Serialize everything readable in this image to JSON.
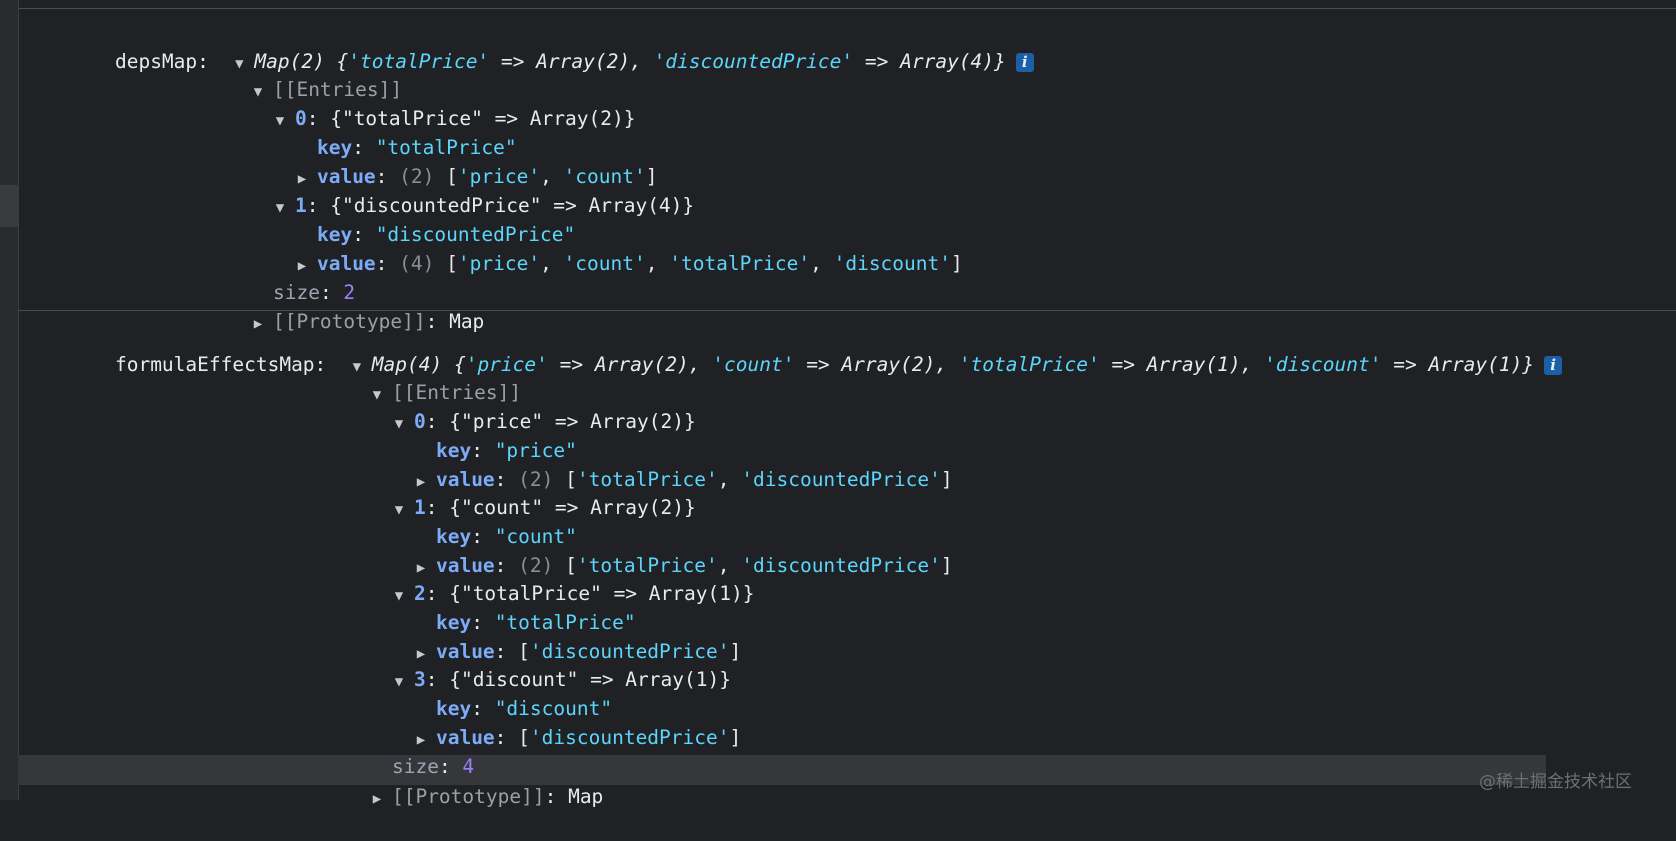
{
  "depsMap": {
    "label": "depsMap:",
    "summary_head": "Map(2) {",
    "summary_k1": "'totalPrice'",
    "summary_v1": " => Array(2), ",
    "summary_k2": "'discountedPrice'",
    "summary_v2": " => Array(4)}",
    "entries_label": "[[Entries]]",
    "entries": [
      {
        "index": "0",
        "summary": " {\"totalPrice\" => Array(2)}",
        "key_label": "key",
        "key_value": "\"totalPrice\"",
        "value_label": "value",
        "value_count": "(2)",
        "value_items": [
          "'price'",
          "'count'"
        ]
      },
      {
        "index": "1",
        "summary": " {\"discountedPrice\" => Array(4)}",
        "key_label": "key",
        "key_value": "\"discountedPrice\"",
        "value_label": "value",
        "value_count": "(4)",
        "value_items": [
          "'price'",
          "'count'",
          "'totalPrice'",
          "'discount'"
        ]
      }
    ],
    "size_label": "size",
    "size_value": "2",
    "prototype_label": "[[Prototype]]",
    "prototype_value": "Map"
  },
  "formulaEffectsMap": {
    "label": "formulaEffectsMap:",
    "summary_head": "Map(4) {",
    "pairs": [
      {
        "k": "'price'",
        "v": " => Array(2), "
      },
      {
        "k": "'count'",
        "v": " => Array(2), "
      },
      {
        "k": "'totalPrice'",
        "v": " => Array(1), "
      },
      {
        "k": "'discount'",
        "v": " => Array(1)}"
      }
    ],
    "entries_label": "[[Entries]]",
    "entries": [
      {
        "index": "0",
        "summary": " {\"price\" => Array(2)}",
        "key_label": "key",
        "key_value": "\"price\"",
        "value_label": "value",
        "value_count": "(2)",
        "value_items": [
          "'totalPrice'",
          "'discountedPrice'"
        ]
      },
      {
        "index": "1",
        "summary": " {\"count\" => Array(2)}",
        "key_label": "key",
        "key_value": "\"count\"",
        "value_label": "value",
        "value_count": "(2)",
        "value_items": [
          "'totalPrice'",
          "'discountedPrice'"
        ]
      },
      {
        "index": "2",
        "summary": " {\"totalPrice\" => Array(1)}",
        "key_label": "key",
        "key_value": "\"totalPrice\"",
        "value_label": "value",
        "value_count": "",
        "value_items": [
          "'discountedPrice'"
        ]
      },
      {
        "index": "3",
        "summary": " {\"discount\" => Array(1)}",
        "key_label": "key",
        "key_value": "\"discount\"",
        "value_label": "value",
        "value_count": "",
        "value_items": [
          "'discountedPrice'"
        ]
      }
    ],
    "size_label": "size",
    "size_value": "4",
    "prototype_label": "[[Prototype]]",
    "prototype_value": "Map"
  },
  "icons": {
    "expanded": "triangle-down-icon",
    "collapsed": "triangle-right-icon",
    "info": "info-icon"
  },
  "info_glyph": "i",
  "watermark": "@稀土掘金技术社区",
  "colors": {
    "background": "#202124",
    "string": "#5cd5fb",
    "property": "#7cacf8",
    "number": "#9980ff",
    "info_badge": "#1a5fa8"
  }
}
